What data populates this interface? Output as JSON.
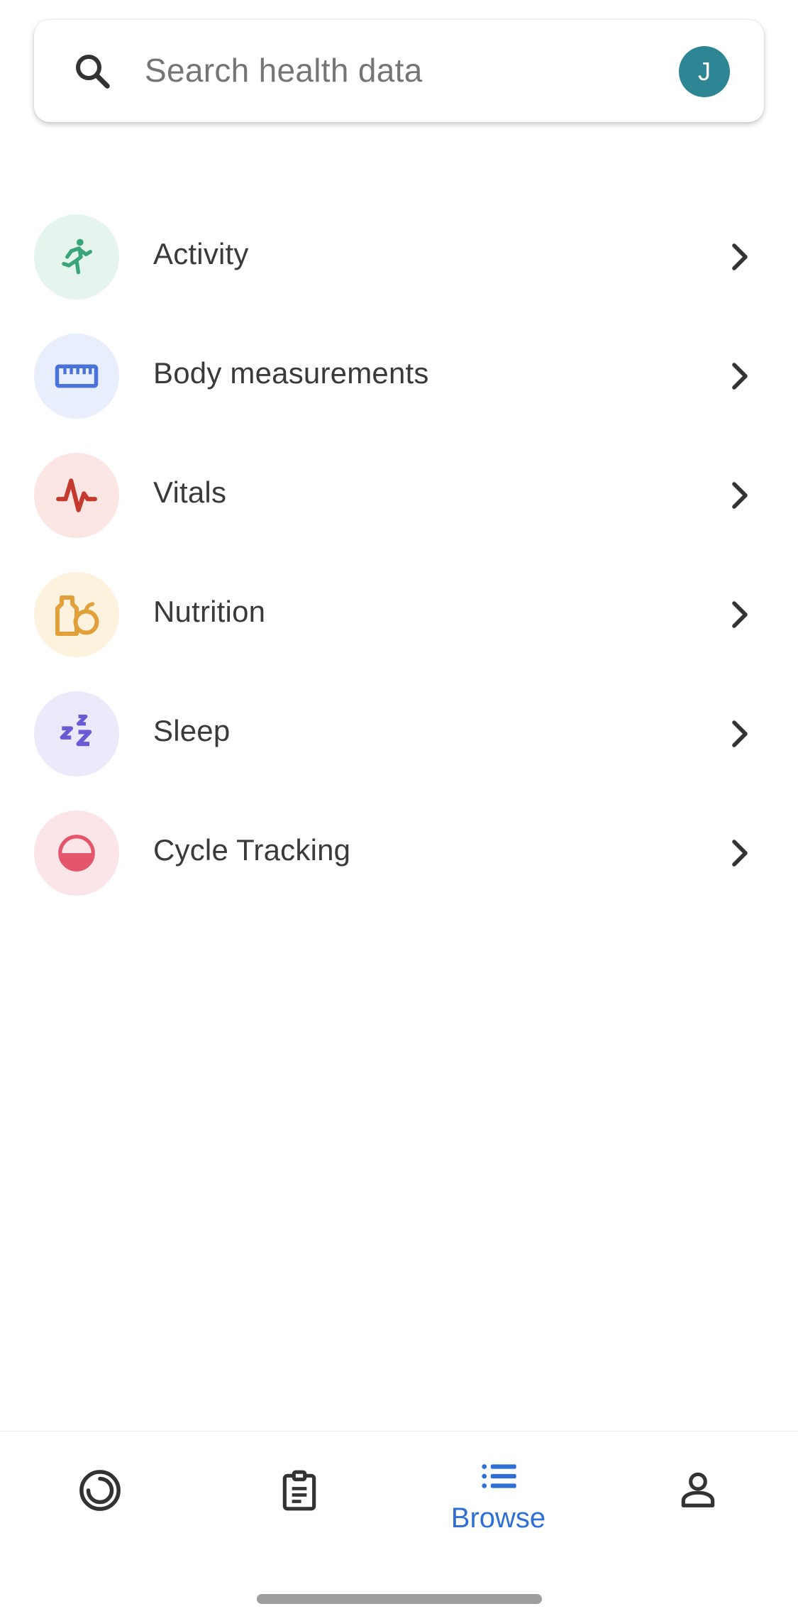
{
  "search": {
    "placeholder": "Search health data",
    "avatar_initial": "J",
    "avatar_color": "#2e8593"
  },
  "categories": [
    {
      "label": "Activity",
      "icon": "running-figure-icon",
      "color": "#3aa57a",
      "bg": "#e5f5ee"
    },
    {
      "label": "Body measurements",
      "icon": "ruler-icon",
      "color": "#4a73d9",
      "bg": "#e8eefc"
    },
    {
      "label": "Vitals",
      "icon": "heartbeat-icon",
      "color": "#c43a2f",
      "bg": "#fbe6e4"
    },
    {
      "label": "Nutrition",
      "icon": "nutrition-icon",
      "color": "#e2a03a",
      "bg": "#fdf2de"
    },
    {
      "label": "Sleep",
      "icon": "zzz-icon",
      "color": "#6a5bd4",
      "bg": "#ece9fb"
    },
    {
      "label": "Cycle Tracking",
      "icon": "half-circle-icon",
      "color": "#e4566b",
      "bg": "#fbe5e8"
    }
  ],
  "bottom_nav": {
    "items": [
      {
        "name": "today",
        "icon": "ring-icon",
        "label": ""
      },
      {
        "name": "journal",
        "icon": "clipboard-icon",
        "label": ""
      },
      {
        "name": "browse",
        "icon": "list-icon",
        "label": "Browse",
        "active": true
      },
      {
        "name": "profile",
        "icon": "person-icon",
        "label": ""
      }
    ],
    "active_color": "#2f6fd6"
  }
}
